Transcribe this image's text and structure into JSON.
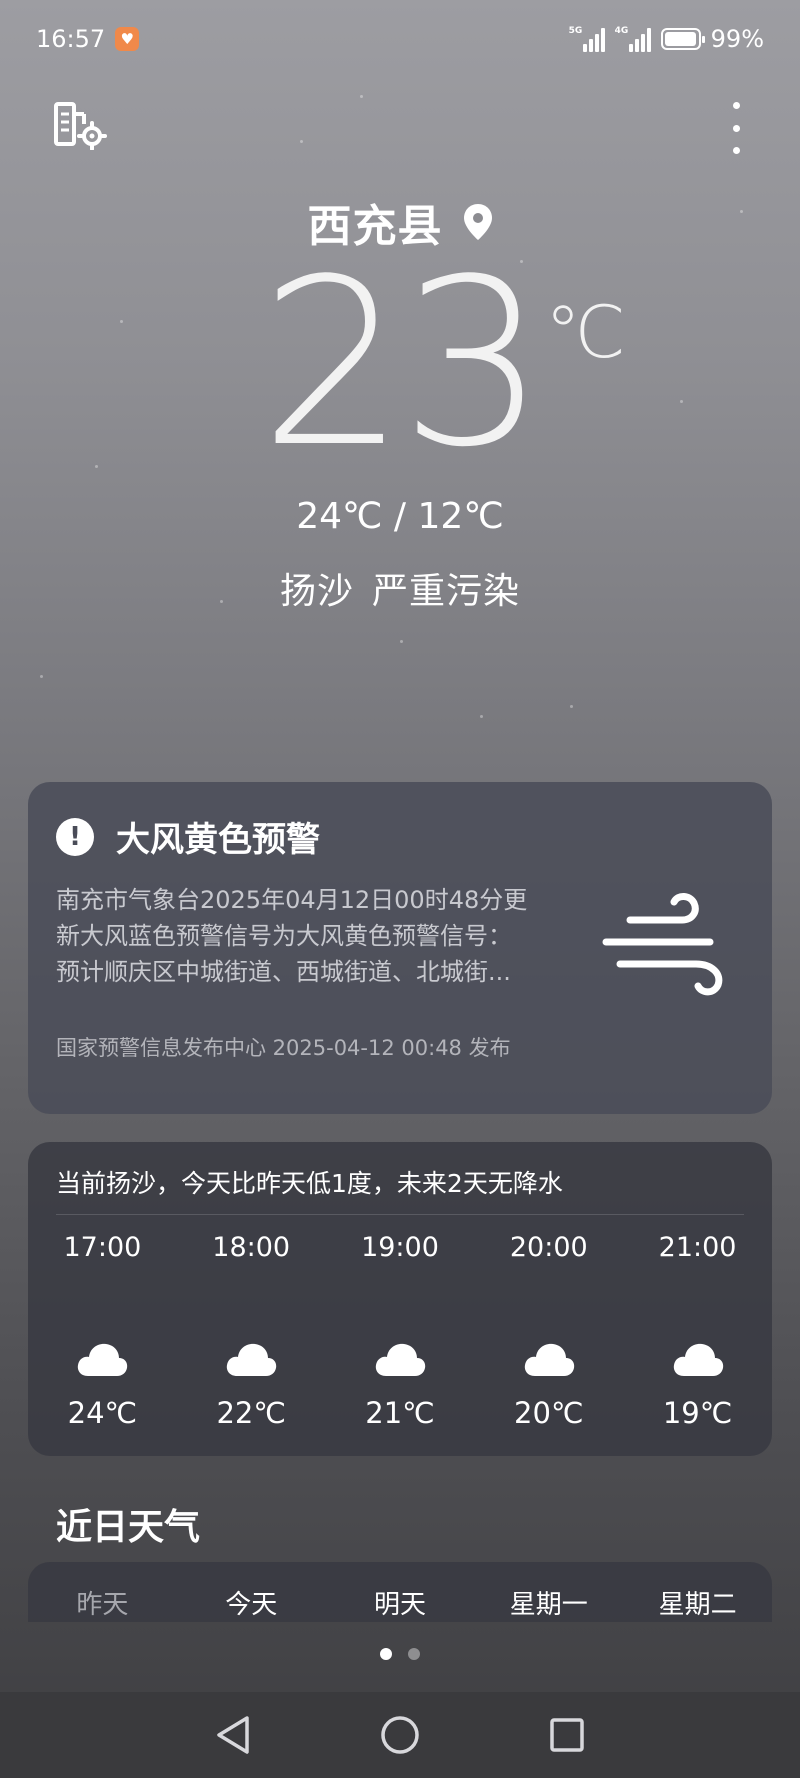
{
  "status_bar": {
    "time": "16:57",
    "sim1_tag": "5G",
    "sim2_tag": "4G",
    "battery": "99%",
    "battery_level": 0.99
  },
  "header": {
    "settings_icon": "city-settings-icon",
    "menu_icon": "more-vertical-icon"
  },
  "location": {
    "name": "西充县",
    "icon": "location-pin-icon"
  },
  "current": {
    "temperature": "23",
    "unit": "℃",
    "range": "24℃ / 12℃",
    "condition": "扬沙",
    "air_quality": "严重污染"
  },
  "alert": {
    "title": "大风黄色预警",
    "body_lines": [
      "南充市气象台2025年04月12日00时48分更",
      "新大风蓝色预警信号为大风黄色预警信号：",
      "预计顺庆区中城街道、西城街道、北城街..."
    ],
    "source": "国家预警信息发布中心 2025-04-12 00:48 发布",
    "icon": "strong-wind-icon"
  },
  "hourly": {
    "summary": "当前扬沙，今天比昨天低1度，未来2天无降水",
    "items": [
      {
        "time": "17:00",
        "icon": "cloudy-icon",
        "temp": "24℃"
      },
      {
        "time": "18:00",
        "icon": "cloudy-icon",
        "temp": "22℃"
      },
      {
        "time": "19:00",
        "icon": "cloudy-icon",
        "temp": "21℃"
      },
      {
        "time": "20:00",
        "icon": "cloudy-icon",
        "temp": "20℃"
      },
      {
        "time": "21:00",
        "icon": "cloudy-icon",
        "temp": "19℃"
      }
    ]
  },
  "daily": {
    "title": "近日天气",
    "days": [
      "昨天",
      "今天",
      "明天",
      "星期一",
      "星期二"
    ]
  },
  "pager": {
    "count": 2,
    "active": 0
  },
  "nav": {
    "back_icon": "back-triangle-icon",
    "home_icon": "home-circle-icon",
    "recents_icon": "recents-square-icon"
  },
  "colors": {
    "background_top": "#9d9da2",
    "background_bottom": "#3e3e41",
    "card": "#4a4c58",
    "badge": "#f0894a"
  }
}
